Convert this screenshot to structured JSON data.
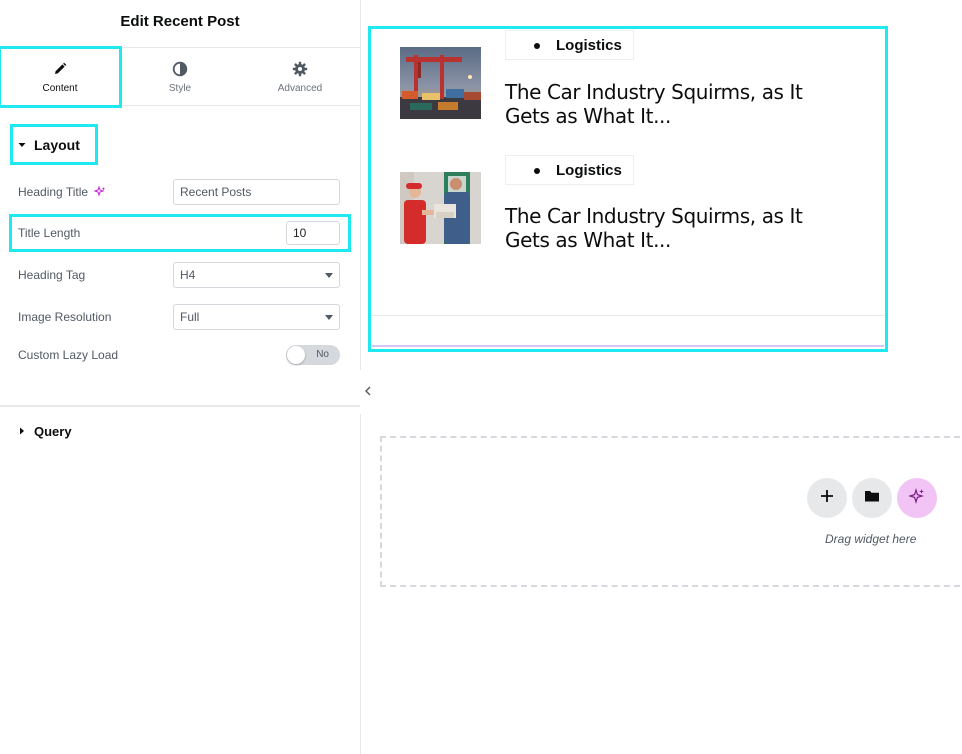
{
  "panel": {
    "title": "Edit Recent Post",
    "tabs": [
      {
        "label": "Content",
        "icon": "pencil-icon",
        "active": true
      },
      {
        "label": "Style",
        "icon": "half-circle-icon",
        "active": false
      },
      {
        "label": "Advanced",
        "icon": "gear-icon",
        "active": false
      }
    ],
    "sections": {
      "layout": {
        "label": "Layout",
        "expanded": true
      },
      "query": {
        "label": "Query",
        "expanded": false
      }
    },
    "controls": {
      "heading_title": {
        "label": "Heading Title",
        "value": "Recent Posts"
      },
      "title_length": {
        "label": "Title Length",
        "value": "10"
      },
      "heading_tag": {
        "label": "Heading Tag",
        "value": "H4"
      },
      "image_resolution": {
        "label": "Image Resolution",
        "value": "Full"
      },
      "custom_lazy_load": {
        "label": "Custom Lazy Load",
        "value": "No"
      }
    }
  },
  "canvas": {
    "posts": [
      {
        "category": "Logistics",
        "title": "The Car Industry Squirms, as It Gets as What It..."
      },
      {
        "category": "Logistics",
        "title": "The Car Industry Squirms, as It Gets as What It..."
      }
    ],
    "drop_zone": {
      "label": "Drag widget here"
    }
  },
  "colors": {
    "highlight": "#1ee8f0",
    "ai_accent": "#f2c4f6",
    "ai_icon": "#c026d3"
  }
}
